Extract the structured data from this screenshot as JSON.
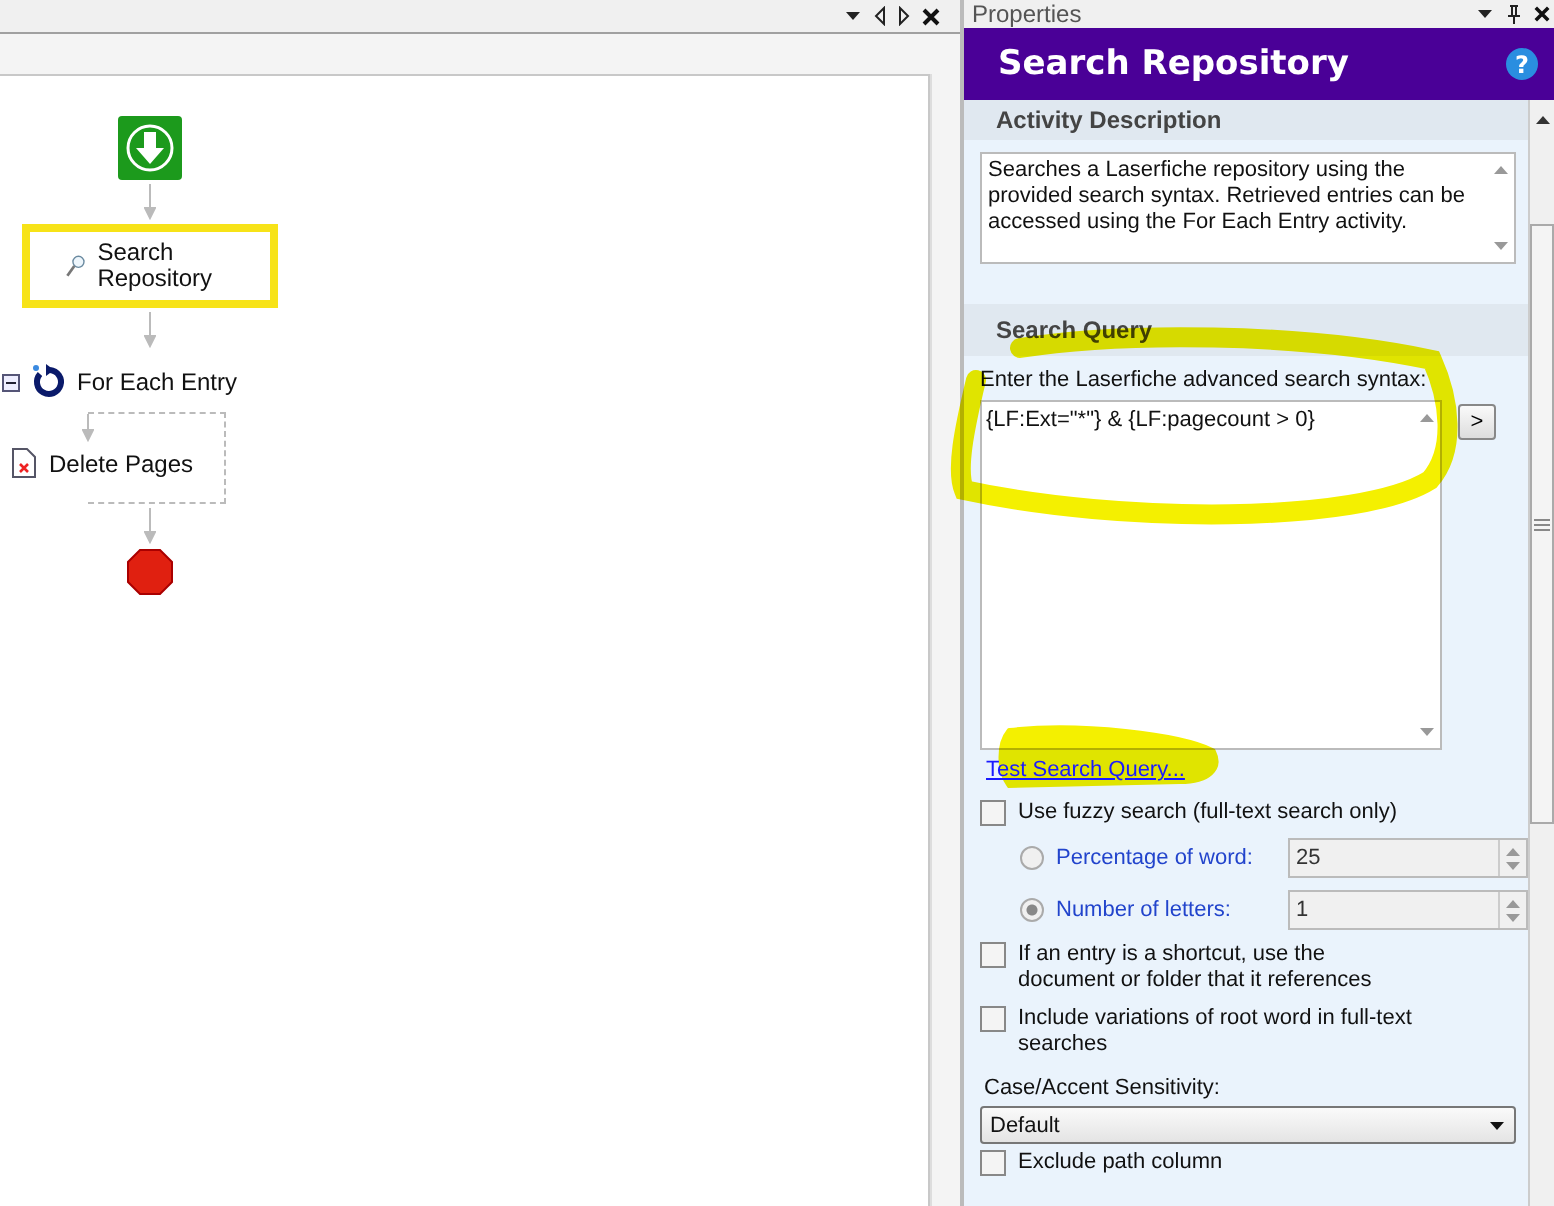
{
  "designer": {
    "nodes": [
      {
        "kind": "start"
      },
      {
        "kind": "search",
        "label": "Search Repository",
        "selected": true
      },
      {
        "kind": "loop",
        "label": "For Each Entry",
        "expanded": true,
        "children": [
          {
            "kind": "delete",
            "label": "Delete Pages",
            "selected": false
          }
        ]
      },
      {
        "kind": "end"
      }
    ]
  },
  "properties": {
    "pane_title": "Properties",
    "header": "Search Repository",
    "help_label": "?",
    "insert_button": ">",
    "description_heading": "Activity Description",
    "description": "Searches a Laserfiche repository using the provided search syntax.  Retrieved entries can be accessed using the For Each Entry activity.",
    "query_heading": "Search Query",
    "query_label": "Enter the Laserfiche advanced search syntax:",
    "query": "{LF:Ext=\"*\"} & {LF:pagecount > 0}",
    "test_link": "Test Search Query...",
    "options": [
      {
        "kind": "checkbox",
        "label": "Use fuzzy search (full-text search only)",
        "checked": false
      },
      {
        "kind": "radio",
        "label": "Percentage of word:",
        "selected": false,
        "value": "25",
        "disabled": true
      },
      {
        "kind": "radio",
        "label": "Number of letters:",
        "selected": true,
        "value": "1",
        "disabled": true
      },
      {
        "kind": "checkbox",
        "label": "If an entry is a shortcut, use the document or folder that it references",
        "checked": false
      },
      {
        "kind": "checkbox",
        "label": "Include variations of root word in full-text searches",
        "checked": false
      },
      {
        "kind": "dropdown",
        "label": "Case/Accent Sensitivity:",
        "value": "Default"
      },
      {
        "kind": "checkbox",
        "label": "Exclude path column",
        "checked": false
      }
    ]
  }
}
